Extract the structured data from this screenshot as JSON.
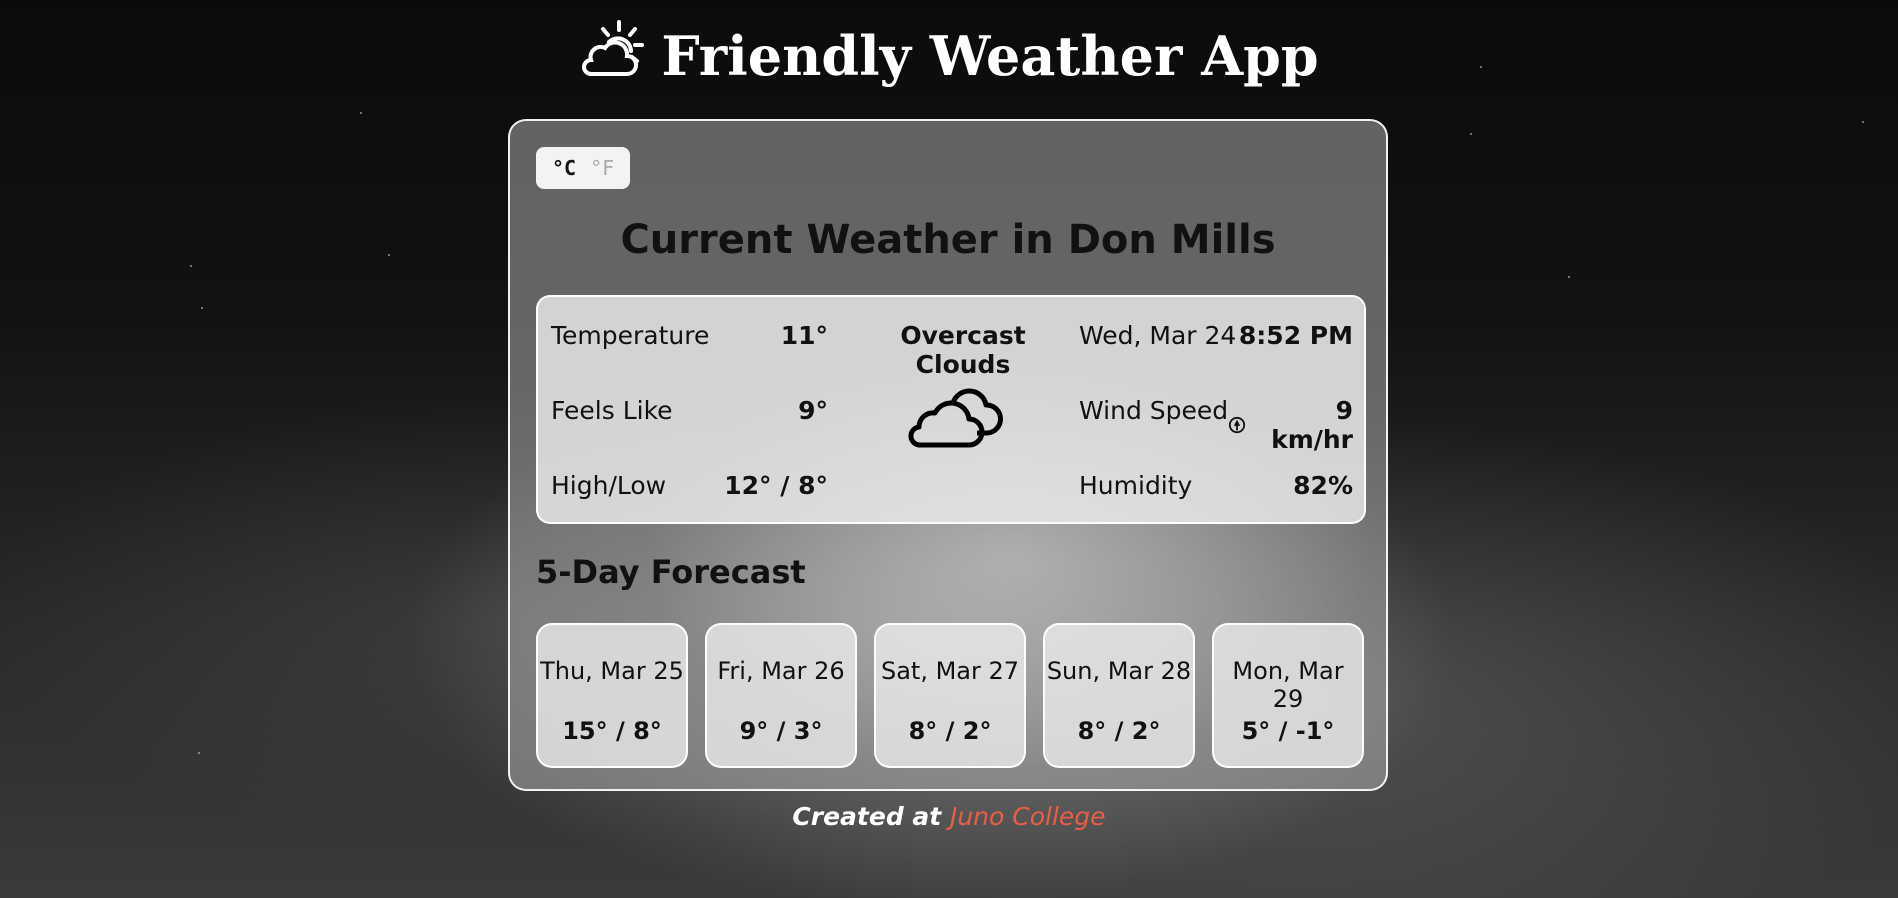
{
  "app": {
    "title": "Friendly Weather App",
    "title_icon": "sun-behind-cloud-icon"
  },
  "units": {
    "celsius_label": "°C",
    "fahrenheit_label": "°F",
    "selected": "°C"
  },
  "current": {
    "heading": "Current Weather in Don Mills",
    "temperature_label": "Temperature",
    "temperature_value": "11°",
    "feels_like_label": "Feels Like",
    "feels_like_value": "9°",
    "high_low_label": "High/Low",
    "high_low_value": "12° / 8°",
    "description": "Overcast Clouds",
    "condition_icon": "cloud-icon",
    "date": "Wed, Mar 24",
    "time": "8:52 PM",
    "wind_label": "Wind Speed",
    "wind_icon": "wind-direction-icon",
    "wind_value": "9 km/hr",
    "humidity_label": "Humidity",
    "humidity_value": "82%"
  },
  "forecast": {
    "heading": "5-Day Forecast",
    "days": [
      {
        "date": "Thu, Mar 25",
        "temps": "15° / 8°"
      },
      {
        "date": "Fri, Mar 26",
        "temps": "9° / 3°"
      },
      {
        "date": "Sat, Mar 27",
        "temps": "8° / 2°"
      },
      {
        "date": "Sun, Mar 28",
        "temps": "8° / 2°"
      },
      {
        "date": "Mon, Mar 29",
        "temps": "5° / -1°"
      }
    ]
  },
  "footer": {
    "prefix": "Created at",
    "link_text": "Juno College",
    "link_color": "#e85f45"
  }
}
